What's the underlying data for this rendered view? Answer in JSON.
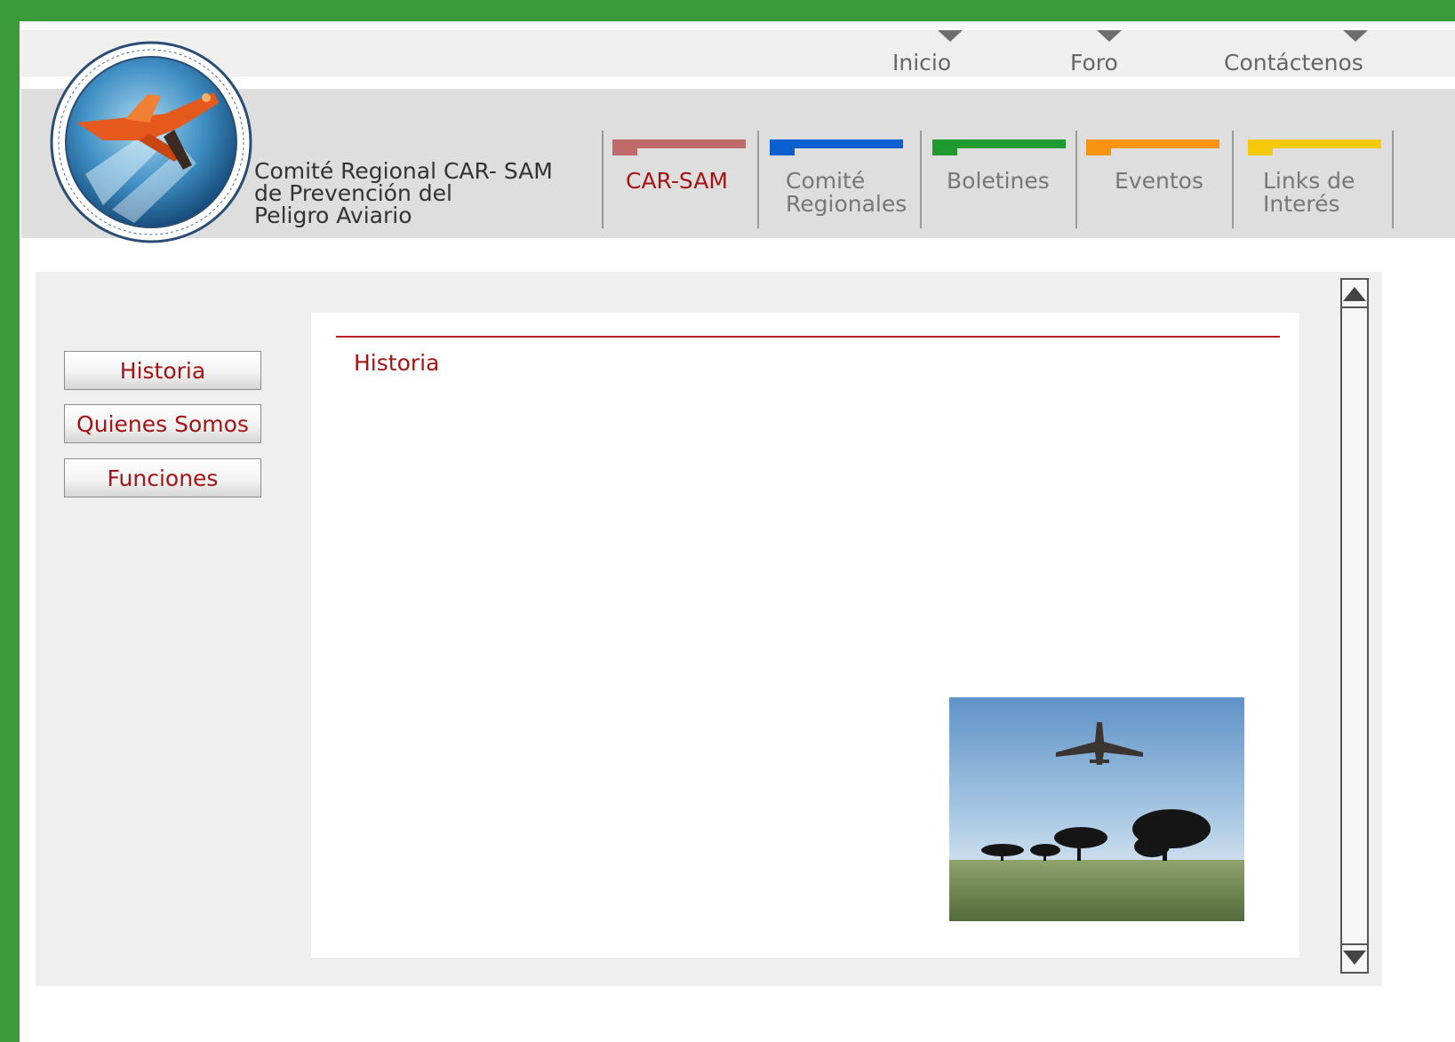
{
  "top_nav": {
    "items": [
      {
        "label": "Inicio"
      },
      {
        "label": "Foro"
      },
      {
        "label": "Contáctenos"
      }
    ]
  },
  "org": {
    "name_lines": [
      "Comité Regional CAR- SAM",
      "de Prevención del",
      "Peligro Aviario"
    ],
    "logo_icon": "airplane-seal-logo"
  },
  "main_nav": {
    "tabs": [
      {
        "label_lines": [
          "CAR-SAM"
        ],
        "color": "#c06a6a",
        "active": true
      },
      {
        "label_lines": [
          "Comité",
          "Regionales"
        ],
        "color": "#0a5fd0",
        "active": false
      },
      {
        "label_lines": [
          "Boletines"
        ],
        "color": "#1e9a2e",
        "active": false
      },
      {
        "label_lines": [
          "Eventos"
        ],
        "color": "#f7930e",
        "active": false
      },
      {
        "label_lines": [
          "Links de",
          "Interés"
        ],
        "color": "#f6c80a",
        "active": false
      }
    ]
  },
  "sidebar": {
    "buttons": [
      {
        "label": "Historia"
      },
      {
        "label": "Quienes Somos"
      },
      {
        "label": "Funciones"
      }
    ]
  },
  "content": {
    "title": "Historia",
    "accent_color": "#a31515"
  }
}
